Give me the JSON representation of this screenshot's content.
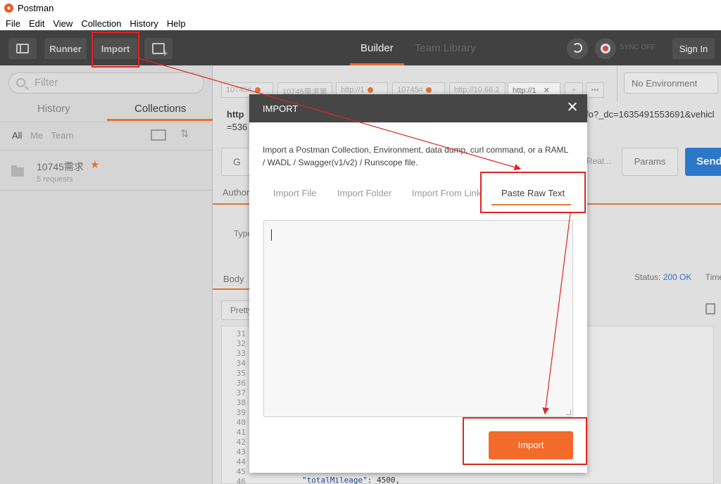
{
  "window": {
    "title": "Postman"
  },
  "menu": [
    "File",
    "Edit",
    "View",
    "Collection",
    "History",
    "Help"
  ],
  "toolbar": {
    "runner": "Runner",
    "import": "Import",
    "builder": "Builder",
    "team_library": "Team Library",
    "sync": "SYNC OFF",
    "sign_in": "Sign In"
  },
  "sidebar": {
    "filter_placeholder": "Filter",
    "tabs": [
      "History",
      "Collections"
    ],
    "chips": [
      "All",
      "Me",
      "Team"
    ],
    "collection": {
      "name": "10745需求",
      "count": "5 requests"
    }
  },
  "main": {
    "tabs": [
      "10745#",
      "10745需求第",
      "http://1",
      "10745#",
      "http://10.66.2",
      "http://1"
    ],
    "environment": "No Environment",
    "url_left": "http",
    "url_left2": "=536",
    "url_right": "fo?_dc=1635491553691&vehicl",
    "method_initial": "G",
    "real": "Real...",
    "params": "Params",
    "send": "Send",
    "auth_tab": "Author",
    "type_label": "Type",
    "body_tab": "Body",
    "status_label": "Status:",
    "status_value": "200 OK",
    "time_label": "Time:",
    "pretty": "Pretty",
    "line_numbers": [
      "31",
      "32",
      "33",
      "34",
      "35",
      "36",
      "37",
      "38",
      "39",
      "40",
      "41",
      "42",
      "43",
      "44",
      "45",
      "46"
    ],
    "code_key": "\"totalMileage\"",
    "code_val": ": 4500,"
  },
  "modal": {
    "title": "IMPORT",
    "description": "Import a Postman Collection, Environment, data dump, curl command, or a RAML / WADL / Swagger(v1/v2) / Runscope file.",
    "tabs": [
      "Import File",
      "Import Folder",
      "Import From Link",
      "Paste Raw Text"
    ],
    "active_tab": "Paste Raw Text",
    "import_button": "Import"
  },
  "colors": {
    "accent": "#ef7a3a",
    "annotation": "#e02424",
    "send": "#2f7fd6"
  }
}
